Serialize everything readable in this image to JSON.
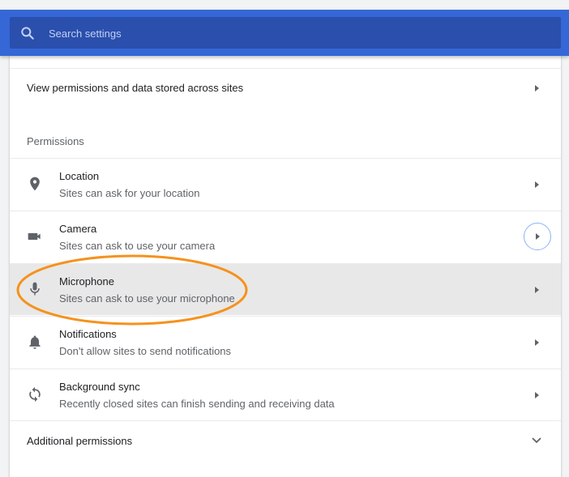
{
  "search": {
    "placeholder": "Search settings",
    "value": ""
  },
  "links": {
    "view_permissions_label": "View permissions and data stored across sites"
  },
  "permissions": {
    "section_title": "Permissions",
    "items": [
      {
        "title": "Location",
        "subtitle": "Sites can ask for your location",
        "icon": "location-pin-icon"
      },
      {
        "title": "Camera",
        "subtitle": "Sites can ask to use your camera",
        "icon": "camera-icon"
      },
      {
        "title": "Microphone",
        "subtitle": "Sites can ask to use your microphone",
        "icon": "microphone-icon",
        "highlighted": true
      },
      {
        "title": "Notifications",
        "subtitle": "Don't allow sites to send notifications",
        "icon": "bell-icon"
      },
      {
        "title": "Background sync",
        "subtitle": "Recently closed sites can finish sending and receiving data",
        "icon": "sync-icon"
      }
    ]
  },
  "additional": {
    "label": "Additional permissions"
  },
  "colors": {
    "header": "#3567d6",
    "search_box": "#2a4fad",
    "highlight_row": "#e8e8e8",
    "annotation": "#f5921e",
    "focus_ring": "#8ab4f8"
  }
}
